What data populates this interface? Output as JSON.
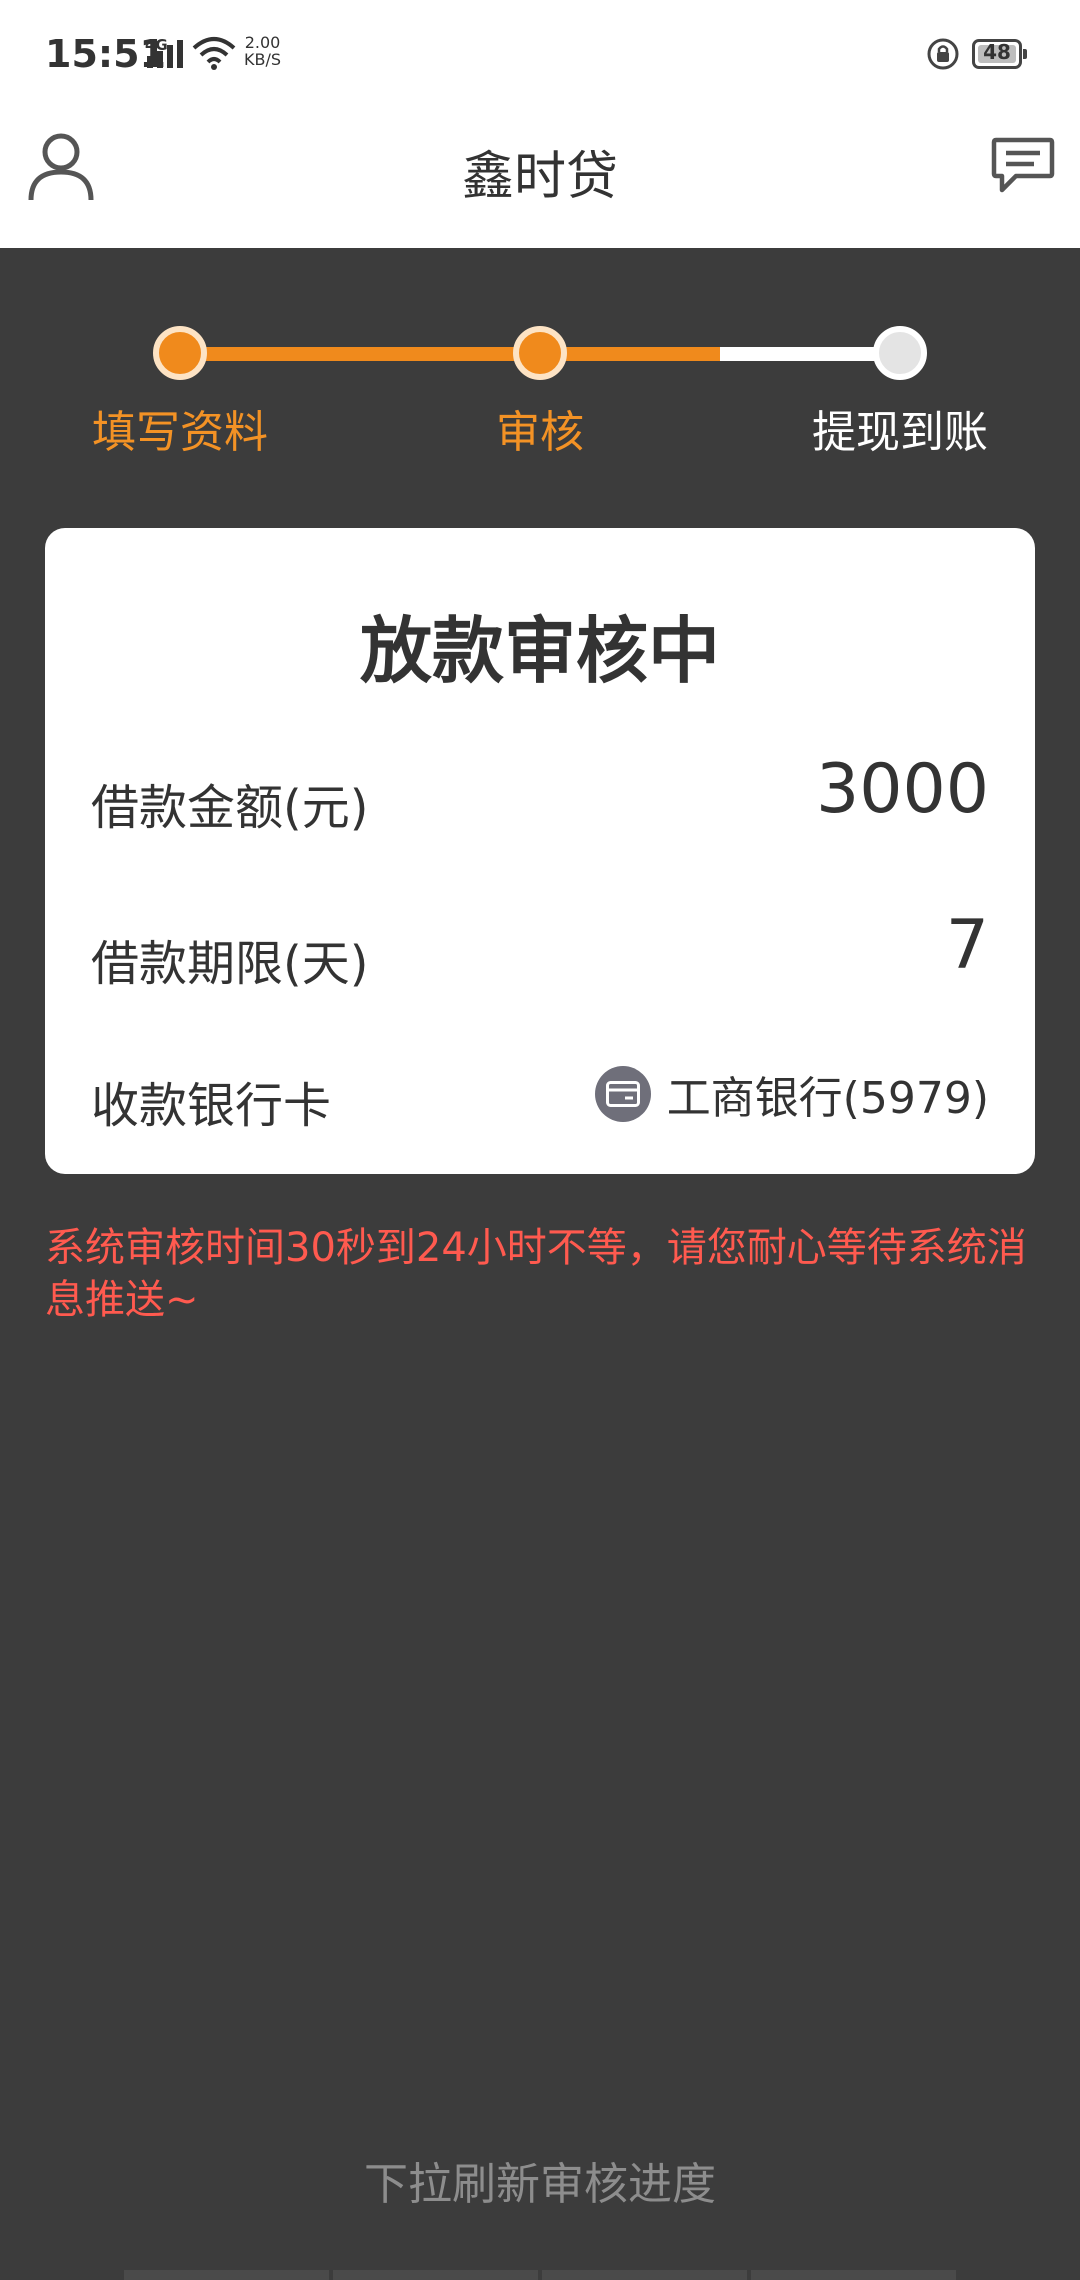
{
  "status_bar": {
    "time": "15:51",
    "network_type": "4G",
    "speed_value": "2.00",
    "speed_unit": "KB/S",
    "battery": "48"
  },
  "header": {
    "title": "鑫时贷",
    "left_icon": "user-icon",
    "right_icon": "message-icon"
  },
  "steps": [
    {
      "label": "填写资料",
      "state": "done"
    },
    {
      "label": "审核",
      "state": "done"
    },
    {
      "label": "提现到账",
      "state": "pending"
    }
  ],
  "card": {
    "title": "放款审核中",
    "amount_label": "借款金额(元)",
    "amount_value": "3000",
    "term_label": "借款期限(天)",
    "term_value": "7",
    "bank_label": "收款银行卡",
    "bank_value": "工商银行(5979)"
  },
  "notice": "系统审核时间30秒到24小时不等，请您耐心等待系统消息推送~",
  "footer_hint": "下拉刷新审核进度",
  "colors": {
    "accent": "#f08a1c",
    "notice": "#ff5a4f",
    "background": "#3c3c3c"
  }
}
